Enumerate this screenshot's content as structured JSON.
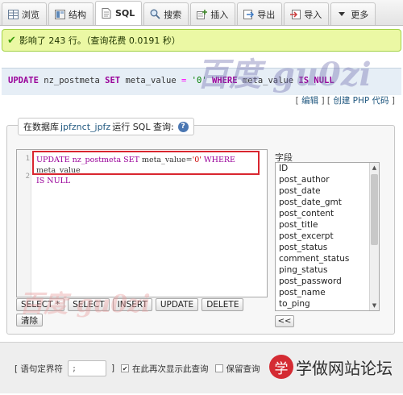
{
  "tabs": [
    {
      "label": "浏览",
      "icon": "table-icon"
    },
    {
      "label": "结构",
      "icon": "structure-icon"
    },
    {
      "label": "SQL",
      "icon": "sql-icon",
      "active": true
    },
    {
      "label": "搜索",
      "icon": "search-icon"
    },
    {
      "label": "插入",
      "icon": "insert-icon"
    },
    {
      "label": "导出",
      "icon": "export-icon"
    },
    {
      "label": "导入",
      "icon": "import-icon"
    },
    {
      "label": "更多",
      "icon": "chevron-down-icon"
    }
  ],
  "message": {
    "text": "影响了 243 行。（查询花费 0.0191 秒）"
  },
  "sql_echo": {
    "update": "UPDATE",
    "table": "nz_postmeta",
    "set": "SET",
    "col": "meta_value",
    "eq": "=",
    "value": "'0'",
    "where": "WHERE",
    "col2": "meta_value",
    "is": "IS",
    "null": "NULL"
  },
  "links": {
    "edit": "编辑",
    "create_php": "创建 PHP 代码"
  },
  "query_panel": {
    "prefix": "在数据库",
    "database": "jpfznct_jpfz",
    "suffix": "运行 SQL 查询:",
    "help_icon": "?"
  },
  "editor": {
    "line_numbers": [
      "1",
      "2"
    ],
    "line1_a": "UPDATE nz_postmeta ",
    "line1_set": "SET",
    "line1_b": " meta_value=",
    "line1_val": "'0'",
    "line1_where": " WHERE",
    "line1_c": " meta_value",
    "line2": "IS NULL"
  },
  "buttons": {
    "select_star": "SELECT *",
    "select": "SELECT",
    "insert": "INSERT",
    "update": "UPDATE",
    "delete": "DELETE",
    "clear": "清除"
  },
  "fields": {
    "label": "字段",
    "items": [
      "ID",
      "post_author",
      "post_date",
      "post_date_gmt",
      "post_content",
      "post_title",
      "post_excerpt",
      "post_status",
      "comment_status",
      "ping_status",
      "post_password",
      "post_name",
      "to_ping"
    ],
    "insert_button": "<<"
  },
  "bottom": {
    "delimiter_label": "[ 语句定界符",
    "delimiter_value": ";",
    "close_bracket": "]",
    "show_again_label": "在此再次显示此查询",
    "show_again_checked": true,
    "keep_label": "保留查询"
  },
  "watermarks": {
    "top": "百度 gu0zi",
    "bottom": "百度 gu0zi"
  },
  "brand": {
    "badge": "学",
    "text": "学做网站论坛"
  }
}
